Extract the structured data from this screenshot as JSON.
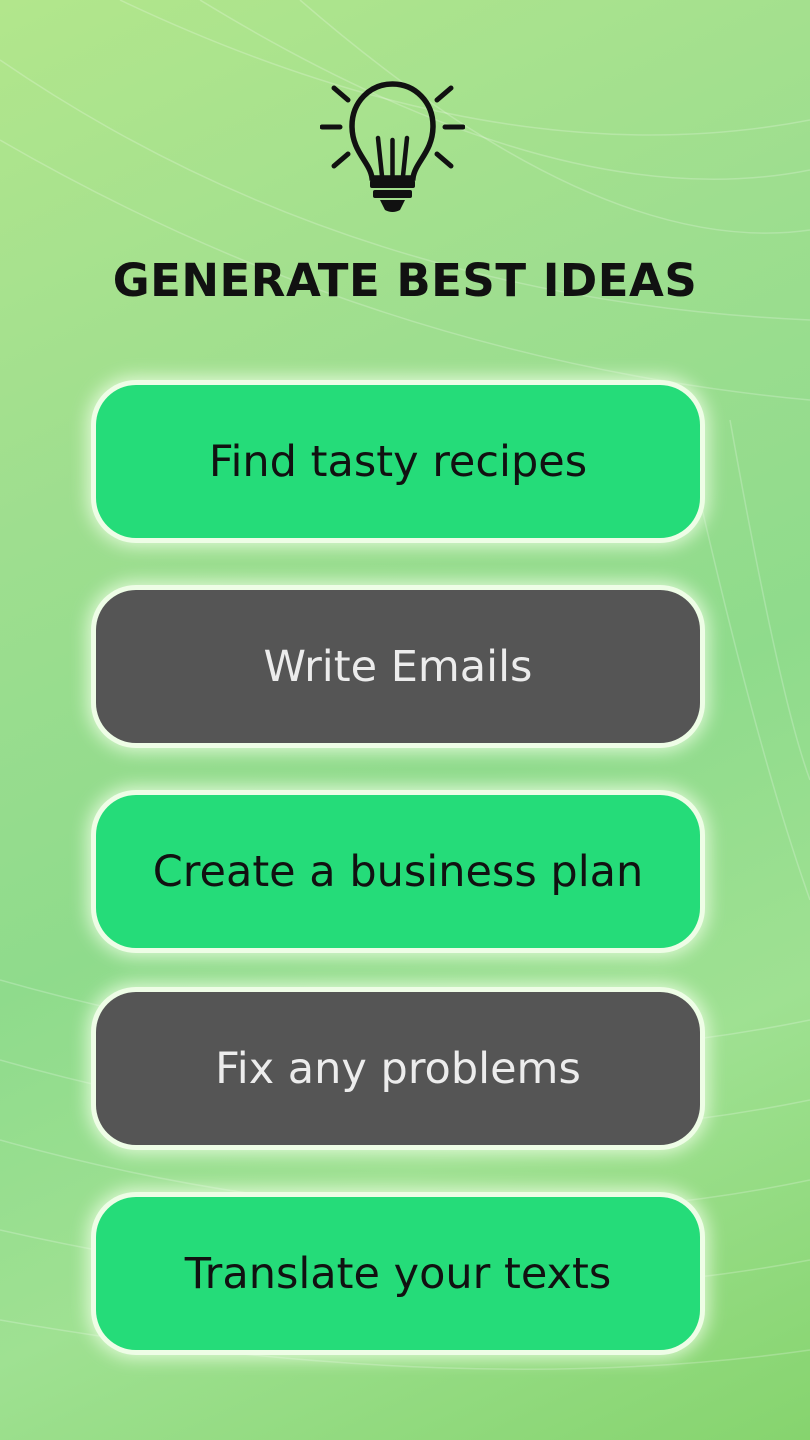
{
  "header": {
    "icon": "lightbulb-icon",
    "title": "GENERATE BEST IDEAS"
  },
  "options": [
    {
      "label": "Find tasty recipes",
      "style": "green"
    },
    {
      "label": "Write Emails",
      "style": "dark"
    },
    {
      "label": "Create a business plan",
      "style": "green"
    },
    {
      "label": "Fix any problems",
      "style": "dark"
    },
    {
      "label": "Translate your texts",
      "style": "green"
    }
  ],
  "colors": {
    "accent_green": "#25dc79",
    "dark_button": "#555555",
    "glow": "#eefde6"
  }
}
